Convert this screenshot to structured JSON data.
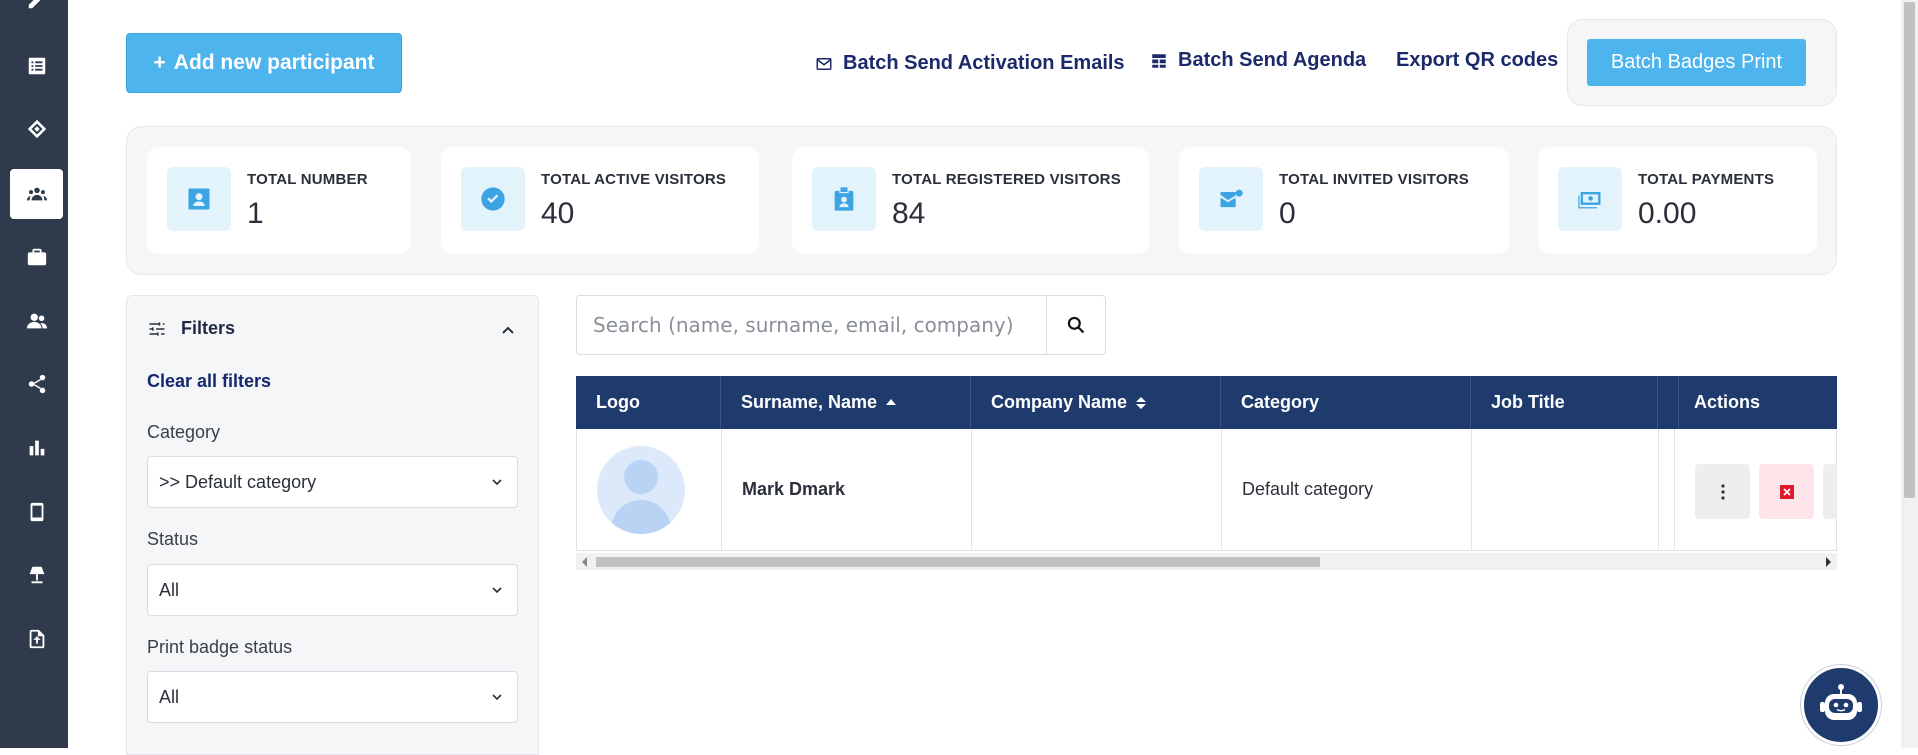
{
  "sidebar": {
    "items": [
      {
        "icon": "pencil-icon"
      },
      {
        "icon": "list-icon"
      },
      {
        "icon": "ticket-icon"
      },
      {
        "icon": "participants-icon",
        "active": true
      },
      {
        "icon": "briefcase-icon"
      },
      {
        "icon": "users-icon"
      },
      {
        "icon": "share-icon"
      },
      {
        "icon": "bar-chart-icon"
      },
      {
        "icon": "mobile-icon"
      },
      {
        "icon": "lamp-icon"
      },
      {
        "icon": "file-upload-icon"
      }
    ]
  },
  "toolbar": {
    "add_label": "Add new participant",
    "batch_activation_label": "Batch Send Activation Emails",
    "batch_agenda_label": "Batch Send Agenda",
    "export_qr_label": "Export QR codes",
    "batch_badges_label": "Batch Badges Print"
  },
  "stats": [
    {
      "label": "TOTAL NUMBER",
      "value": "1",
      "icon": "contact-card-icon"
    },
    {
      "label": "TOTAL ACTIVE VISITORS",
      "value": "40",
      "icon": "check-circle-icon"
    },
    {
      "label": "TOTAL REGISTERED VISITORS",
      "value": "84",
      "icon": "id-badge-icon"
    },
    {
      "label": "TOTAL INVITED VISITORS",
      "value": "0",
      "icon": "mail-notification-icon"
    },
    {
      "label": "TOTAL PAYMENTS",
      "value": "0.00",
      "icon": "money-icon"
    }
  ],
  "filters": {
    "title": "Filters",
    "clear_label": "Clear all filters",
    "fields": [
      {
        "label": "Category",
        "value": ">> Default category"
      },
      {
        "label": "Status",
        "value": "All"
      },
      {
        "label": "Print badge status",
        "value": "All"
      }
    ]
  },
  "search": {
    "placeholder": "Search (name, surname, email, company)"
  },
  "table": {
    "columns": [
      "Logo",
      "Surname, Name",
      "Company Name",
      "Category",
      "Job Title",
      "Actions"
    ],
    "rows": [
      {
        "name": "Mark Dmark",
        "company": "",
        "category": "Default category",
        "job_title": ""
      }
    ]
  },
  "colors": {
    "accent": "#4db4ee",
    "header_bg": "#1f3b6e",
    "sidebar_bg": "#2f3b4c",
    "delete_bg": "#fde4e8",
    "delete_icon": "#e0162b"
  }
}
